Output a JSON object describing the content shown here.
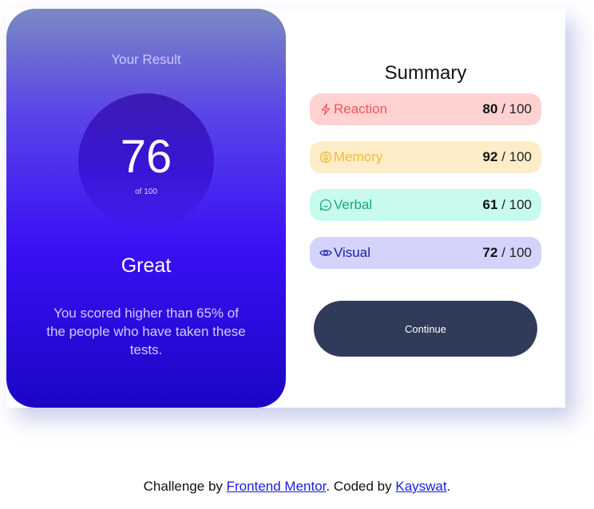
{
  "result": {
    "title": "Your Result",
    "score": "76",
    "score_max": "of 100",
    "grade": "Great",
    "description": "You scored higher than 65% of the people who have taken these tests."
  },
  "summary": {
    "title": "Summary",
    "max": "/ 100",
    "rows": [
      {
        "label": "Reaction",
        "score": "80",
        "icon": "lightning-icon",
        "color": "#f5555c",
        "bg": "#ffd1d1"
      },
      {
        "label": "Memory",
        "score": "92",
        "icon": "brain-icon",
        "color": "#f2b83a",
        "bg": "#fdedc9"
      },
      {
        "label": "Verbal",
        "score": "61",
        "icon": "chat-bubble-icon",
        "color": "#12a883",
        "bg": "#c8fbee"
      },
      {
        "label": "Visual",
        "score": "72",
        "icon": "eye-icon",
        "color": "#1d22a8",
        "bg": "#d4d3fb"
      }
    ],
    "button_label": "Continue"
  },
  "footer": {
    "prefix": "Challenge by",
    "link1": "Frontend Mentor",
    "middle": ". Coded by",
    "link2": "Kayswat",
    "suffix": "."
  },
  "colors": {
    "button_bg": "#303b5a",
    "panel_top": "#7a8ac2",
    "panel_bottom": "#1a06c4"
  }
}
